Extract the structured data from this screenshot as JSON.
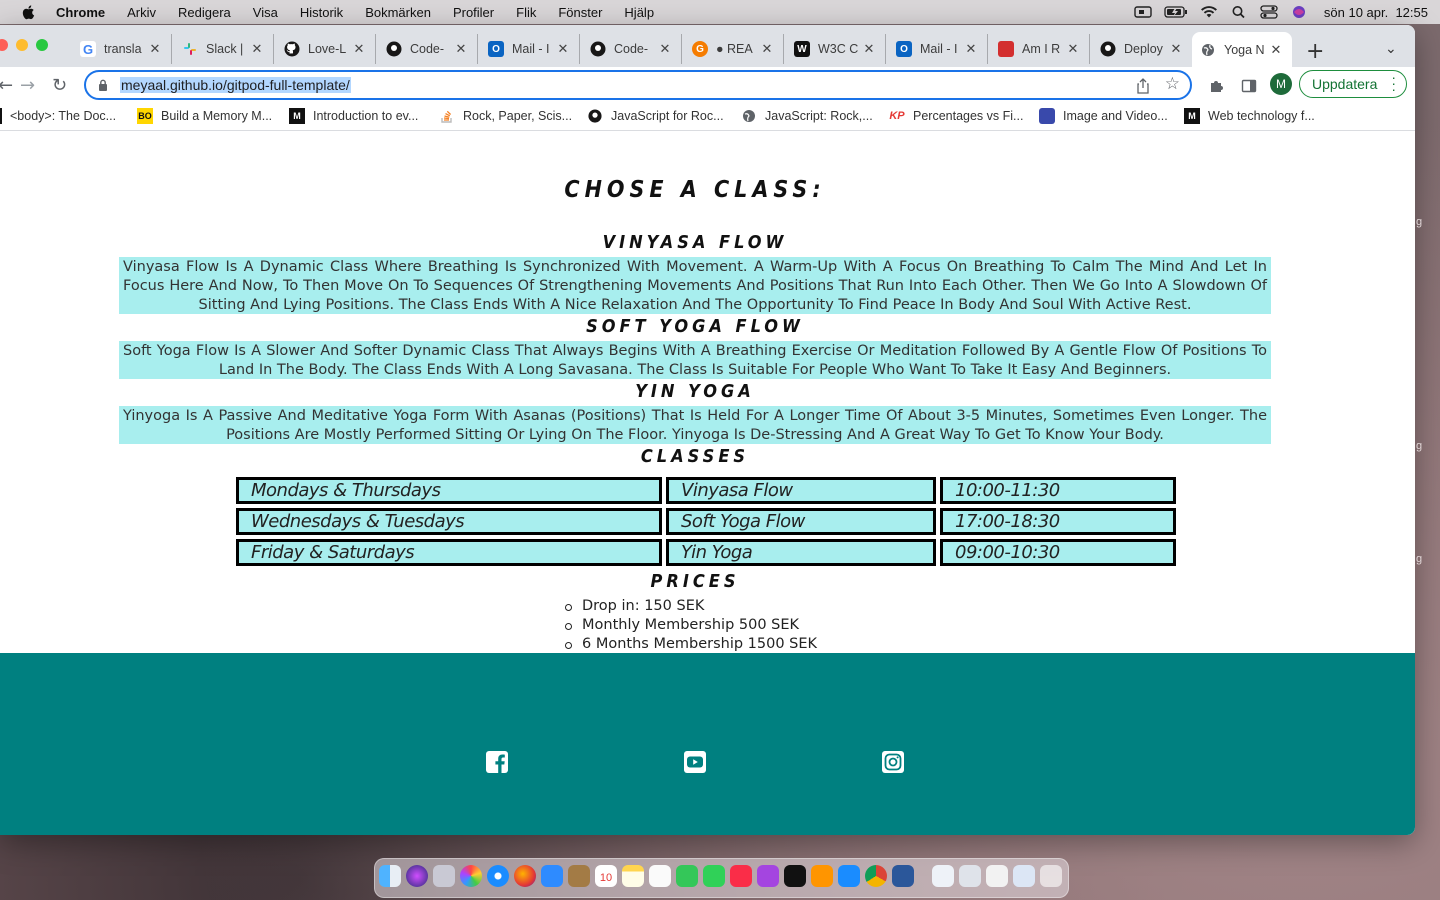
{
  "menubar": {
    "app": "Chrome",
    "items": [
      "Arkiv",
      "Redigera",
      "Visa",
      "Historik",
      "Bokmärken",
      "Profiler",
      "Flik",
      "Fönster",
      "Hjälp"
    ],
    "clock": "sön 10 apr.  12:55"
  },
  "tabs": [
    {
      "label": "transla",
      "icon": "google-icon",
      "color": "#4285f4"
    },
    {
      "label": "Slack |",
      "icon": "slack-icon",
      "color": "#e01e5a"
    },
    {
      "label": "Love-L",
      "icon": "github-icon",
      "color": "#181717"
    },
    {
      "label": "Code-",
      "icon": "github-icon",
      "color": "#181717"
    },
    {
      "label": "Mail - I",
      "icon": "outlook-icon",
      "color": "#0a64c2"
    },
    {
      "label": "Code-",
      "icon": "github-icon",
      "color": "#181717"
    },
    {
      "label": "● REA",
      "icon": "grammarly-icon",
      "color": "#f57c00"
    },
    {
      "label": "W3C C",
      "icon": "w3c-icon",
      "color": "#111111"
    },
    {
      "label": "Mail - I",
      "icon": "outlook-icon",
      "color": "#0a64c2"
    },
    {
      "label": "Am I R",
      "icon": "amiresponsive-icon",
      "color": "#d32f2f"
    },
    {
      "label": "Deploy",
      "icon": "github-icon",
      "color": "#181717"
    },
    {
      "label": "Yoga N",
      "icon": "globe-icon",
      "color": "#5f6368"
    }
  ],
  "address": {
    "url": "meyaal.github.io/gitpod-full-template/"
  },
  "profile_initial": "M",
  "update_label": "Uppdatera",
  "bookmarks": [
    {
      "label": "<body>: The Doc...",
      "icon": "mdn-icon"
    },
    {
      "label": "Build a Memory M...",
      "icon": "bo-icon"
    },
    {
      "label": "Introduction to ev...",
      "icon": "mdn-icon"
    },
    {
      "label": "Rock, Paper, Scis...",
      "icon": "stackoverflow-icon"
    },
    {
      "label": "JavaScript for Roc...",
      "icon": "github-icon"
    },
    {
      "label": "JavaScript: Rock,...",
      "icon": "globe-icon"
    },
    {
      "label": "Percentages vs Fi...",
      "icon": "kp-icon"
    },
    {
      "label": "Image and Video...",
      "icon": "image-icon"
    },
    {
      "label": "Web technology f...",
      "icon": "mdn-icon"
    }
  ],
  "page": {
    "heading": "Chose a class:",
    "classes": [
      {
        "title": "Vinyasa Flow",
        "description": "Vinyasa Flow Is A Dynamic Class Where Breathing Is Synchronized With Movement. A Warm-Up With A Focus On Breathing To Calm The Mind And Let In Focus Here And Now, To Then Move On To Sequences Of Strengthening Movements And Positions That Run Into Each Other. Then We Go Into A Slowdown Of Sitting And Lying Positions. The Class Ends With A Nice Relaxation And The Opportunity To Find Peace In Body And Soul With Active Rest."
      },
      {
        "title": "Soft Yoga Flow",
        "description": "Soft Yoga Flow Is A Slower And Softer Dynamic Class That Always Begins With A Breathing Exercise Or Meditation Followed By A Gentle Flow Of Positions To Land In The Body. The Class Ends With A Long Savasana. The Class Is Suitable For People Who Want To Take It Easy And Beginners."
      },
      {
        "title": "Yin Yoga",
        "description": "Yinyoga Is A Passive And Meditative Yoga Form With Asanas (Positions) That Is Held For A Longer Time Of About 3-5 Minutes, Sometimes Even Longer. The Positions Are Mostly Performed Sitting Or Lying On The Floor. Yinyoga Is De-Stressing And A Great Way To Get To Know Your Body."
      }
    ],
    "schedule_heading": "Classes",
    "schedule": [
      {
        "days": "Mondays & Thursdays",
        "class": "Vinyasa Flow",
        "time": "10:00-11:30"
      },
      {
        "days": "Wednesdays & Tuesdays",
        "class": "Soft Yoga Flow",
        "time": "17:00-18:30"
      },
      {
        "days": "Friday & Saturdays",
        "class": "Yin Yoga",
        "time": "09:00-10:30"
      }
    ],
    "prices_heading": "Prices",
    "prices": [
      "Drop in: 150 SEK",
      "Monthly Membership 500 SEK",
      "6 Months Membership 1500 SEK"
    ]
  },
  "footer": {
    "icons": [
      "facebook-icon",
      "youtube-icon",
      "instagram-icon"
    ],
    "color": "#008080"
  },
  "colors": {
    "accent_box": "#a8eeee",
    "footer": "#008080",
    "update_green": "#137333"
  },
  "dock_calendar_day": "10"
}
